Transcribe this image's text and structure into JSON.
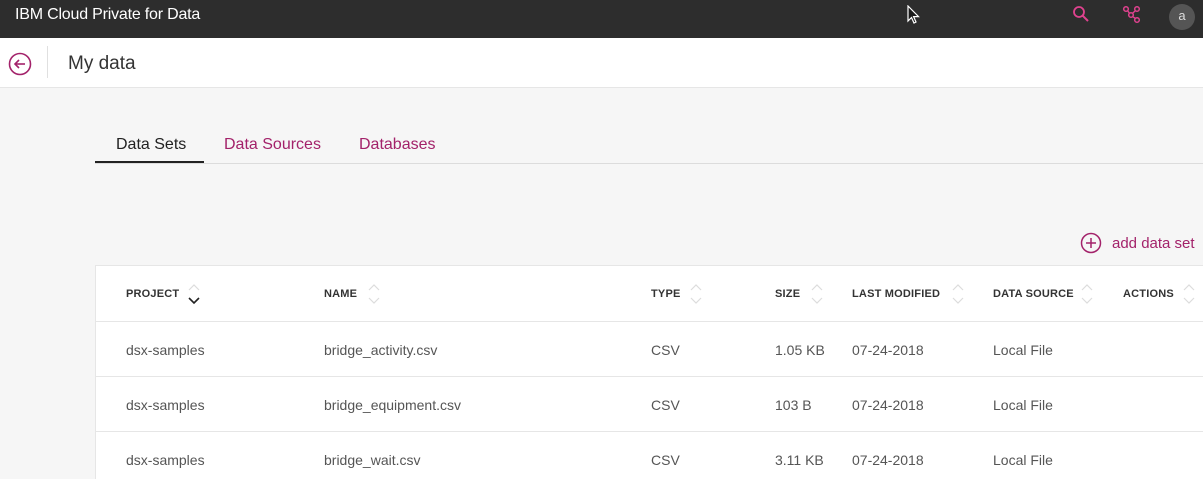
{
  "topbar": {
    "app_title": "IBM Cloud Private for Data",
    "avatar_initial": "a",
    "accent": "#e0428f"
  },
  "header": {
    "page_title": "My data"
  },
  "tabs": [
    {
      "label": "Data Sets",
      "active": true
    },
    {
      "label": "Data Sources",
      "active": false
    },
    {
      "label": "Databases",
      "active": false
    }
  ],
  "actions": {
    "add_data_set": "add data set"
  },
  "table": {
    "columns": [
      "PROJECT",
      "NAME",
      "TYPE",
      "SIZE",
      "LAST MODIFIED",
      "DATA SOURCE",
      "ACTIONS"
    ],
    "sorted_column": "PROJECT",
    "rows": [
      {
        "project": "dsx-samples",
        "name": "bridge_activity.csv",
        "type": "CSV",
        "size": "1.05 KB",
        "modified": "07-24-2018",
        "source": "Local File"
      },
      {
        "project": "dsx-samples",
        "name": "bridge_equipment.csv",
        "type": "CSV",
        "size": "103 B",
        "modified": "07-24-2018",
        "source": "Local File"
      },
      {
        "project": "dsx-samples",
        "name": "bridge_wait.csv",
        "type": "CSV",
        "size": "3.11 KB",
        "modified": "07-24-2018",
        "source": "Local File"
      }
    ]
  },
  "colors": {
    "brand": "#a3226a",
    "topbar_bg": "#2d2d2d"
  }
}
